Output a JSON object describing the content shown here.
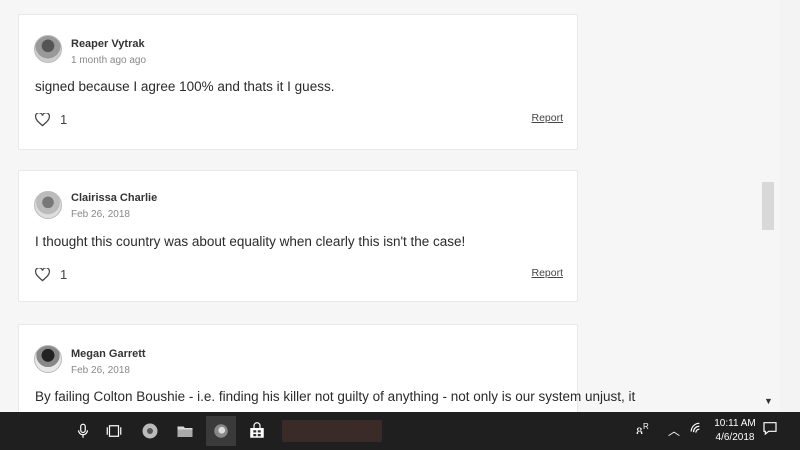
{
  "comments": [
    {
      "author": "Reaper Vytrak",
      "date": "1 month ago ago",
      "text": "signed because I agree 100% and thats it I guess.",
      "likes": "1",
      "report": "Report"
    },
    {
      "author": "Clairissa Charlie",
      "date": "Feb 26, 2018",
      "text": "I thought this country was about equality when clearly this isn't the case!",
      "likes": "1",
      "report": "Report"
    },
    {
      "author": "Megan Garrett",
      "date": "Feb 26, 2018",
      "text": "By failing Colton Boushie - i.e. finding his killer not guilty of anything - not only is our system unjust, it"
    }
  ],
  "taskbar": {
    "time": "10:11 AM",
    "date": "4/6/2018",
    "icons": [
      "microphone-icon",
      "task-view-icon",
      "browser-icon",
      "file-explorer-icon",
      "firefox-icon",
      "store-icon"
    ],
    "tray": [
      "people-icon",
      "chevron-up-icon",
      "wifi-icon",
      "notification-icon"
    ]
  }
}
